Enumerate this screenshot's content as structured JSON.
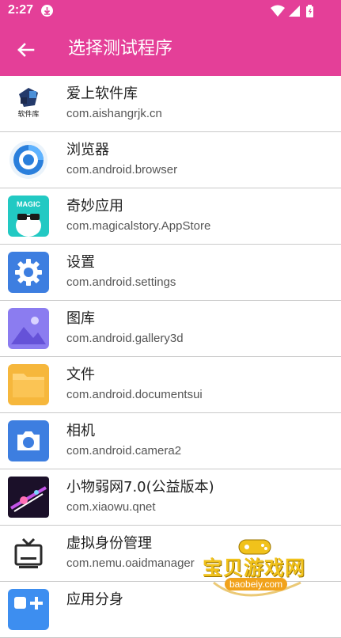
{
  "status_bar": {
    "time": "2:27"
  },
  "app_bar": {
    "title": "选择测试程序"
  },
  "apps": [
    {
      "name": "爱上软件库",
      "package": "com.aishangrjk.cn",
      "icon": "aishang-app-icon",
      "icon_text": "软件库"
    },
    {
      "name": "浏览器",
      "package": "com.android.browser",
      "icon": "browser-app-icon"
    },
    {
      "name": "奇妙应用",
      "package": "com.magicalstory.AppStore",
      "icon": "magic-app-icon",
      "icon_text": "MAGIC"
    },
    {
      "name": "设置",
      "package": "com.android.settings",
      "icon": "settings-app-icon"
    },
    {
      "name": "图库",
      "package": "com.android.gallery3d",
      "icon": "gallery-app-icon"
    },
    {
      "name": "文件",
      "package": "com.android.documentsui",
      "icon": "files-app-icon"
    },
    {
      "name": "相机",
      "package": "com.android.camera2",
      "icon": "camera-app-icon"
    },
    {
      "name": "小物弱网7.0(公益版本)",
      "package": "com.xiaowu.qnet",
      "icon": "xiaowu-app-icon"
    },
    {
      "name": "虚拟身份管理",
      "package": "com.nemu.oaidmanager",
      "icon": "tv-app-icon"
    },
    {
      "name": "应用分身",
      "package": "",
      "icon": "clone-app-icon"
    }
  ],
  "watermark": {
    "text": "宝贝游戏网",
    "domain": "baobeiy.com"
  },
  "colors": {
    "accent": "#e43f98",
    "divider": "#c9c9c9"
  }
}
